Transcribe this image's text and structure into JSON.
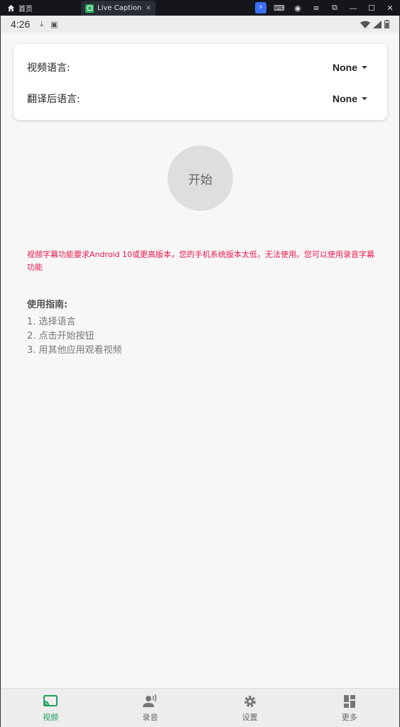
{
  "titlebar": {
    "home_label": "首页",
    "app_tab_label": "Live Caption",
    "close_glyph": "×"
  },
  "statusbar": {
    "time": "4:26"
  },
  "settings": {
    "video_language_label": "视频语言:",
    "video_language_value": "None",
    "translated_language_label": "翻译后语言:",
    "translated_language_value": "None"
  },
  "start_button_label": "开始",
  "warning_text": "视频字幕功能要求Android 10或更高版本，您的手机系统版本太低，无法使用。您可以使用录音字幕功能",
  "guide": {
    "title": "使用指南:",
    "steps": [
      "1. 选择语言",
      "2. 点击开始按钮",
      "3. 用其他应用观看视频"
    ]
  },
  "nav": {
    "items": [
      {
        "label": "视频",
        "icon": "cast-icon"
      },
      {
        "label": "录音",
        "icon": "voice-icon"
      },
      {
        "label": "设置",
        "icon": "gear-icon"
      },
      {
        "label": "更多",
        "icon": "dashboard-icon"
      }
    ]
  },
  "colors": {
    "accent": "#1aa05a",
    "warning": "#e8184a"
  }
}
